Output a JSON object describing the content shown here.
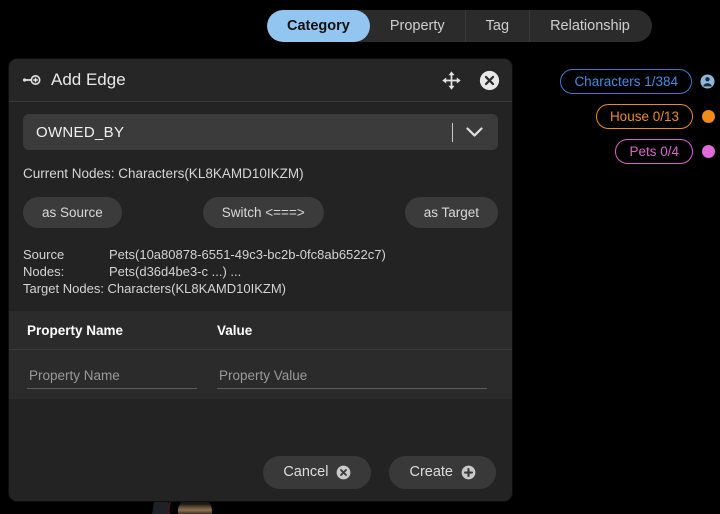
{
  "tabs": [
    {
      "label": "Category",
      "active": true
    },
    {
      "label": "Property",
      "active": false
    },
    {
      "label": "Tag",
      "active": false
    },
    {
      "label": "Relationship",
      "active": false
    }
  ],
  "sidebar": {
    "pills": [
      {
        "label": "Characters 1/384",
        "color": "#3c8fe8",
        "icon": "person-icon"
      },
      {
        "label": "House 0/13",
        "color": "#f08a1a",
        "icon": "orange-dot-icon"
      },
      {
        "label": "Pets 0/4",
        "color": "#e06ad8",
        "icon": "pink-dot-icon"
      }
    ]
  },
  "dialog": {
    "title": "Add Edge",
    "title_icon": "add-edge-icon",
    "move_icon": "move-handle-icon",
    "close_icon": "close-icon",
    "edge_type": {
      "value": "OWNED_BY",
      "caret_icon": "chevron-down-icon"
    },
    "current_nodes_label": "Current Nodes: Characters(KL8KAMD10IKZM)",
    "actions": {
      "as_source": "as Source",
      "switch": "Switch <===>",
      "as_target": "as Target"
    },
    "nodes": {
      "source_label_line1": "Source",
      "source_label_line2": "Nodes:",
      "source_value_line1": "Pets(10a80878-6551-49c3-bc2b-0fc8ab6522c7)",
      "source_value_line2": "Pets(d36d4be3-c ...) ...",
      "target_line": "Target Nodes: Characters(KL8KAMD10IKZM)"
    },
    "properties": {
      "col_name": "Property Name",
      "col_value": "Value",
      "name_placeholder": "Property Name",
      "name_value": "",
      "value_placeholder": "Property Value",
      "value_value": ""
    },
    "footer": {
      "cancel": "Cancel",
      "cancel_icon": "cancel-circle-icon",
      "create": "Create",
      "create_icon": "plus-circle-icon"
    }
  },
  "colors": {
    "accent_tab": "#92c5f0",
    "blue": "#3c8fe8",
    "orange": "#f08a1a",
    "pink": "#e06ad8",
    "dialog_bg": "#232323"
  }
}
